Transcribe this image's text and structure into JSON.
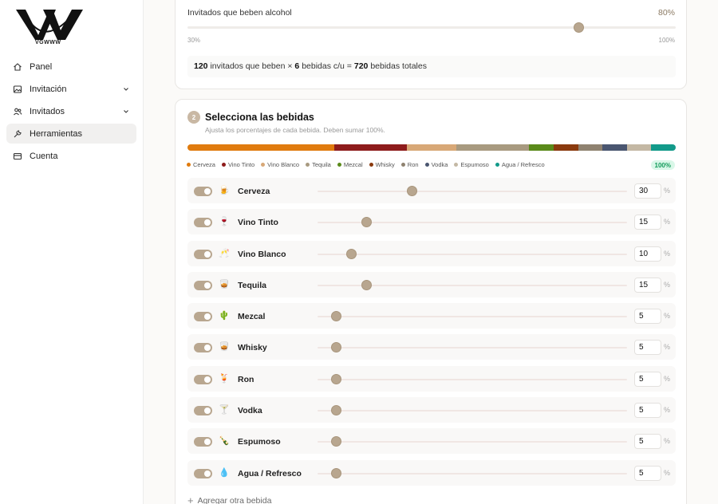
{
  "sidebar": {
    "logo_text": "VGWWW",
    "items": [
      {
        "label": "Panel",
        "icon": "home-icon",
        "active": false,
        "expandable": false
      },
      {
        "label": "Invitación",
        "icon": "image-icon",
        "active": false,
        "expandable": true
      },
      {
        "label": "Invitados",
        "icon": "users-icon",
        "active": false,
        "expandable": true
      },
      {
        "label": "Herramientas",
        "icon": "wrench-icon",
        "active": true,
        "expandable": false
      },
      {
        "label": "Cuenta",
        "icon": "card-icon",
        "active": false,
        "expandable": false
      }
    ]
  },
  "alcohol": {
    "title": "Invitados que beben alcohol",
    "value": 80,
    "value_label": "80%",
    "min": 30,
    "max": 100,
    "min_label": "30%",
    "max_label": "100%",
    "summary": {
      "guests": "120",
      "guests_text": "invitados que beben ×",
      "per_guest": "6",
      "per_guest_text": "bebidas c/u =",
      "total": "720",
      "total_text": "bebidas totales"
    }
  },
  "drinks_section": {
    "step": "2",
    "title": "Selecciona las bebidas",
    "subtitle": "Ajusta los porcentajes de cada bebida. Deben sumar 100%.",
    "total_label": "100%",
    "percent_sign": "%",
    "add_label": "Agregar otra bebida",
    "drinks": [
      {
        "name": "Cerveza",
        "emoji": "🍺",
        "value": 30,
        "color": "#e07b0e",
        "enabled": true
      },
      {
        "name": "Vino Tinto",
        "emoji": "🍷",
        "value": 15,
        "color": "#8e1c1c",
        "enabled": true
      },
      {
        "name": "Vino Blanco",
        "emoji": "🥂",
        "value": 10,
        "color": "#d8a877",
        "enabled": true
      },
      {
        "name": "Tequila",
        "emoji": "🥃",
        "value": 15,
        "color": "#a89a80",
        "enabled": true
      },
      {
        "name": "Mezcal",
        "emoji": "🌵",
        "value": 5,
        "color": "#5a8a1a",
        "enabled": true
      },
      {
        "name": "Whisky",
        "emoji": "🥃",
        "value": 5,
        "color": "#8a3a0e",
        "enabled": true
      },
      {
        "name": "Ron",
        "emoji": "🍹",
        "value": 5,
        "color": "#8f8270",
        "enabled": true
      },
      {
        "name": "Vodka",
        "emoji": "🍸",
        "value": 5,
        "color": "#4a5670",
        "enabled": true
      },
      {
        "name": "Espumoso",
        "emoji": "🍾",
        "value": 5,
        "color": "#c4b8a4",
        "enabled": true
      },
      {
        "name": "Agua / Refresco",
        "emoji": "💧",
        "value": 5,
        "color": "#129a8a",
        "enabled": true
      }
    ]
  }
}
